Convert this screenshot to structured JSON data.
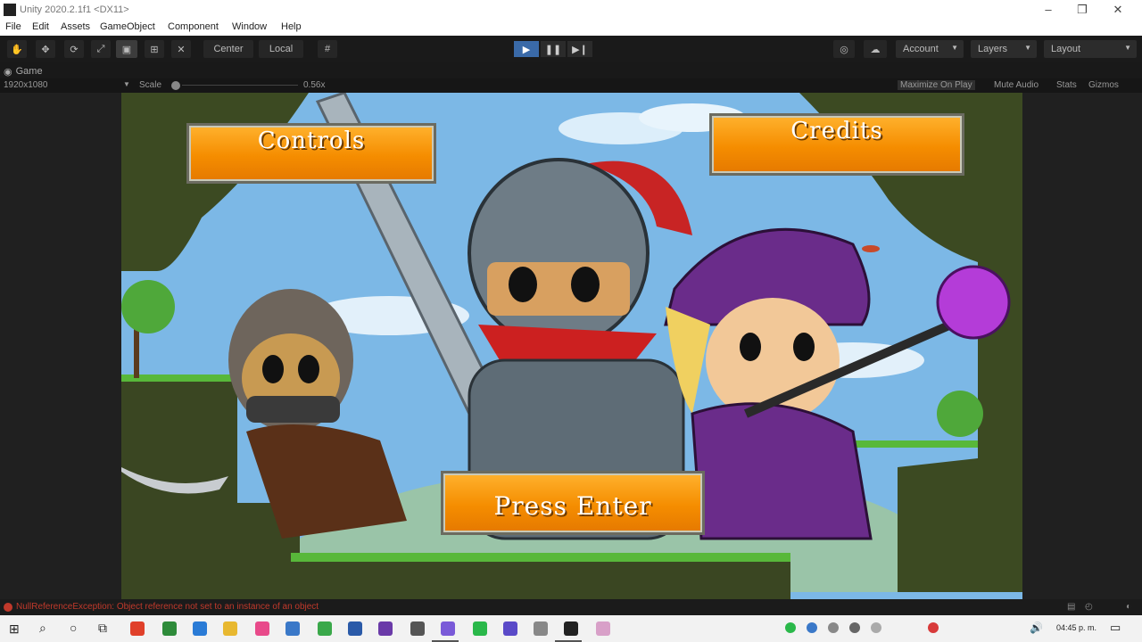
{
  "window": {
    "title": "Unity 2020.2.1f1 <DX11>"
  },
  "menu": [
    "File",
    "Edit",
    "Assets",
    "GameObject",
    "Component",
    "Window",
    "Help"
  ],
  "toolbar": {
    "pivot_center": "Center",
    "pivot_local": "Local",
    "account": "Account",
    "layers": "Layers",
    "layout": "Layout"
  },
  "tab": {
    "label": "Game"
  },
  "gamebar": {
    "resolution": "1920x1080",
    "scale_label": "Scale",
    "scale_value": "0.56x",
    "maximize": "Maximize On Play",
    "mute": "Mute Audio",
    "stats": "Stats",
    "gizmos": "Gizmos"
  },
  "game": {
    "controls": "Controls",
    "credits": "Credits",
    "press_enter": "Press Enter"
  },
  "console": {
    "message": "NullReferenceException: Object reference not set to an instance of an object"
  },
  "taskbar": {
    "time": "04:45 p. m."
  },
  "colors": {
    "accent": "#3a6aa8",
    "button_orange": "#f58d00",
    "error_red": "#c0392b"
  }
}
